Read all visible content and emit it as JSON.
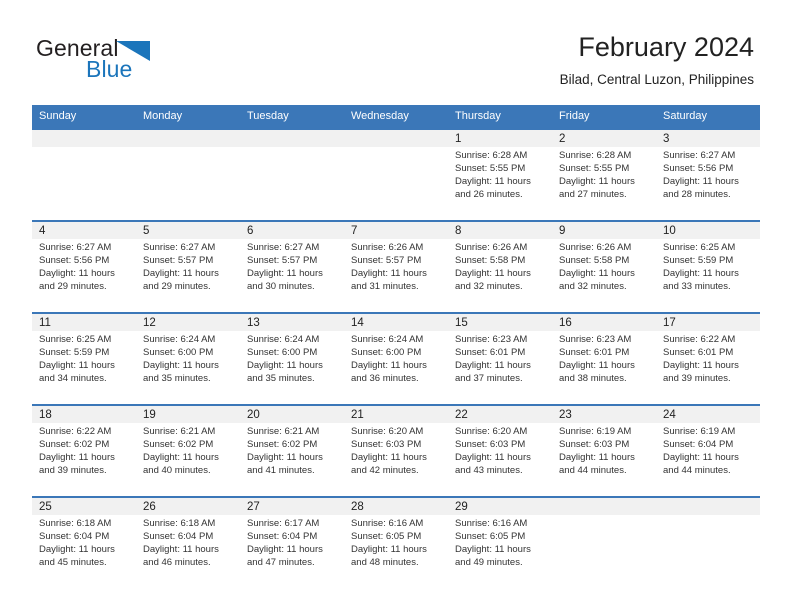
{
  "brand": {
    "name_top": "General",
    "name_bottom": "Blue",
    "flag_icon": "triangle-flag-icon",
    "accent_color": "#1b75bb"
  },
  "header": {
    "title": "February 2024",
    "subtitle": "Bilad, Central Luzon, Philippines"
  },
  "calendar": {
    "header_color": "#3b77b8",
    "day_band_color": "#f1f1f1",
    "weekdays": [
      "Sunday",
      "Monday",
      "Tuesday",
      "Wednesday",
      "Thursday",
      "Friday",
      "Saturday"
    ],
    "weeks": [
      [
        {
          "day": "",
          "empty": true
        },
        {
          "day": "",
          "empty": true
        },
        {
          "day": "",
          "empty": true
        },
        {
          "day": "",
          "empty": true
        },
        {
          "day": "1",
          "sunrise": "Sunrise: 6:28 AM",
          "sunset": "Sunset: 5:55 PM",
          "daylight": "Daylight: 11 hours and 26 minutes."
        },
        {
          "day": "2",
          "sunrise": "Sunrise: 6:28 AM",
          "sunset": "Sunset: 5:55 PM",
          "daylight": "Daylight: 11 hours and 27 minutes."
        },
        {
          "day": "3",
          "sunrise": "Sunrise: 6:27 AM",
          "sunset": "Sunset: 5:56 PM",
          "daylight": "Daylight: 11 hours and 28 minutes."
        }
      ],
      [
        {
          "day": "4",
          "sunrise": "Sunrise: 6:27 AM",
          "sunset": "Sunset: 5:56 PM",
          "daylight": "Daylight: 11 hours and 29 minutes."
        },
        {
          "day": "5",
          "sunrise": "Sunrise: 6:27 AM",
          "sunset": "Sunset: 5:57 PM",
          "daylight": "Daylight: 11 hours and 29 minutes."
        },
        {
          "day": "6",
          "sunrise": "Sunrise: 6:27 AM",
          "sunset": "Sunset: 5:57 PM",
          "daylight": "Daylight: 11 hours and 30 minutes."
        },
        {
          "day": "7",
          "sunrise": "Sunrise: 6:26 AM",
          "sunset": "Sunset: 5:57 PM",
          "daylight": "Daylight: 11 hours and 31 minutes."
        },
        {
          "day": "8",
          "sunrise": "Sunrise: 6:26 AM",
          "sunset": "Sunset: 5:58 PM",
          "daylight": "Daylight: 11 hours and 32 minutes."
        },
        {
          "day": "9",
          "sunrise": "Sunrise: 6:26 AM",
          "sunset": "Sunset: 5:58 PM",
          "daylight": "Daylight: 11 hours and 32 minutes."
        },
        {
          "day": "10",
          "sunrise": "Sunrise: 6:25 AM",
          "sunset": "Sunset: 5:59 PM",
          "daylight": "Daylight: 11 hours and 33 minutes."
        }
      ],
      [
        {
          "day": "11",
          "sunrise": "Sunrise: 6:25 AM",
          "sunset": "Sunset: 5:59 PM",
          "daylight": "Daylight: 11 hours and 34 minutes."
        },
        {
          "day": "12",
          "sunrise": "Sunrise: 6:24 AM",
          "sunset": "Sunset: 6:00 PM",
          "daylight": "Daylight: 11 hours and 35 minutes."
        },
        {
          "day": "13",
          "sunrise": "Sunrise: 6:24 AM",
          "sunset": "Sunset: 6:00 PM",
          "daylight": "Daylight: 11 hours and 35 minutes."
        },
        {
          "day": "14",
          "sunrise": "Sunrise: 6:24 AM",
          "sunset": "Sunset: 6:00 PM",
          "daylight": "Daylight: 11 hours and 36 minutes."
        },
        {
          "day": "15",
          "sunrise": "Sunrise: 6:23 AM",
          "sunset": "Sunset: 6:01 PM",
          "daylight": "Daylight: 11 hours and 37 minutes."
        },
        {
          "day": "16",
          "sunrise": "Sunrise: 6:23 AM",
          "sunset": "Sunset: 6:01 PM",
          "daylight": "Daylight: 11 hours and 38 minutes."
        },
        {
          "day": "17",
          "sunrise": "Sunrise: 6:22 AM",
          "sunset": "Sunset: 6:01 PM",
          "daylight": "Daylight: 11 hours and 39 minutes."
        }
      ],
      [
        {
          "day": "18",
          "sunrise": "Sunrise: 6:22 AM",
          "sunset": "Sunset: 6:02 PM",
          "daylight": "Daylight: 11 hours and 39 minutes."
        },
        {
          "day": "19",
          "sunrise": "Sunrise: 6:21 AM",
          "sunset": "Sunset: 6:02 PM",
          "daylight": "Daylight: 11 hours and 40 minutes."
        },
        {
          "day": "20",
          "sunrise": "Sunrise: 6:21 AM",
          "sunset": "Sunset: 6:02 PM",
          "daylight": "Daylight: 11 hours and 41 minutes."
        },
        {
          "day": "21",
          "sunrise": "Sunrise: 6:20 AM",
          "sunset": "Sunset: 6:03 PM",
          "daylight": "Daylight: 11 hours and 42 minutes."
        },
        {
          "day": "22",
          "sunrise": "Sunrise: 6:20 AM",
          "sunset": "Sunset: 6:03 PM",
          "daylight": "Daylight: 11 hours and 43 minutes."
        },
        {
          "day": "23",
          "sunrise": "Sunrise: 6:19 AM",
          "sunset": "Sunset: 6:03 PM",
          "daylight": "Daylight: 11 hours and 44 minutes."
        },
        {
          "day": "24",
          "sunrise": "Sunrise: 6:19 AM",
          "sunset": "Sunset: 6:04 PM",
          "daylight": "Daylight: 11 hours and 44 minutes."
        }
      ],
      [
        {
          "day": "25",
          "sunrise": "Sunrise: 6:18 AM",
          "sunset": "Sunset: 6:04 PM",
          "daylight": "Daylight: 11 hours and 45 minutes."
        },
        {
          "day": "26",
          "sunrise": "Sunrise: 6:18 AM",
          "sunset": "Sunset: 6:04 PM",
          "daylight": "Daylight: 11 hours and 46 minutes."
        },
        {
          "day": "27",
          "sunrise": "Sunrise: 6:17 AM",
          "sunset": "Sunset: 6:04 PM",
          "daylight": "Daylight: 11 hours and 47 minutes."
        },
        {
          "day": "28",
          "sunrise": "Sunrise: 6:16 AM",
          "sunset": "Sunset: 6:05 PM",
          "daylight": "Daylight: 11 hours and 48 minutes."
        },
        {
          "day": "29",
          "sunrise": "Sunrise: 6:16 AM",
          "sunset": "Sunset: 6:05 PM",
          "daylight": "Daylight: 11 hours and 49 minutes."
        },
        {
          "day": "",
          "empty": true
        },
        {
          "day": "",
          "empty": true
        }
      ]
    ]
  }
}
